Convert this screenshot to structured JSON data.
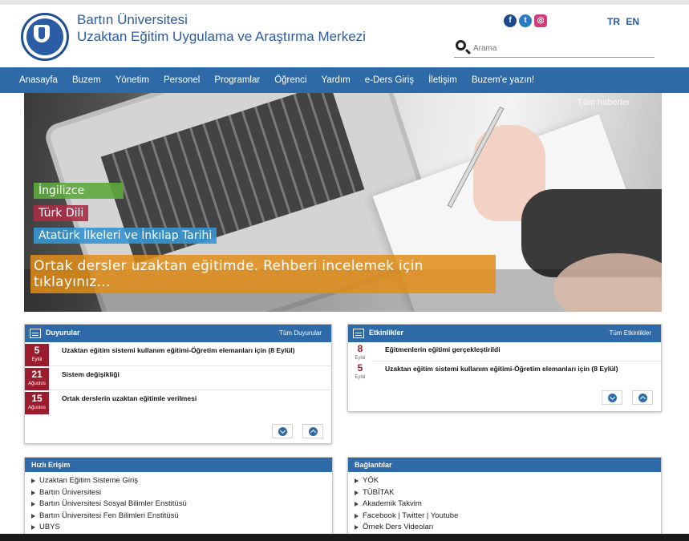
{
  "header": {
    "title_line1": "Bartın Üniversitesi",
    "title_line2": "Uzaktan Eğitim Uygulama ve Araştırma Merkezi",
    "search_placeholder": "Arama",
    "languages": [
      "TR",
      "EN"
    ],
    "social": [
      {
        "name": "facebook",
        "glyph": "f"
      },
      {
        "name": "twitter",
        "glyph": "t"
      },
      {
        "name": "instagram",
        "glyph": "◎"
      }
    ]
  },
  "nav": {
    "items": [
      "Anasayfa",
      "Buzem",
      "Yönetim",
      "Personel",
      "Programlar",
      "Öğrenci",
      "Yardım",
      "e-Ders Giriş",
      "İletişim",
      "Buzem'e yazın!"
    ]
  },
  "hero": {
    "all_news": "Tüm haberler",
    "tags": [
      "İngilizce",
      "Türk Dili",
      "Atatürk İlkeleri ve İnkılap Tarihi"
    ],
    "headline": "Ortak dersler uzaktan eğitimde. Rehberi incelemek için tıklayınız..."
  },
  "announcements": {
    "title": "Duyurular",
    "all_link": "Tüm Duyurular",
    "items": [
      {
        "day": "5",
        "month": "Eylül",
        "text": "Uzaktan eğitim sistemi kullanım eğitimi-Öğretim elemanları için (8 Eylül)"
      },
      {
        "day": "21",
        "month": "Ağustos",
        "text": "Sistem değişikliği"
      },
      {
        "day": "15",
        "month": "Ağustos",
        "text": "Ortak derslerin uzaktan eğitimle verilmesi"
      }
    ]
  },
  "events": {
    "title": "Etkinlikler",
    "all_link": "Tüm Etkinlikler",
    "items": [
      {
        "day": "8",
        "month": "Eylül",
        "text": "Eğitmenlerin eğitimi gerçekleştirildi"
      },
      {
        "day": "5",
        "month": "Eylül",
        "text": "Uzaktan eğitim sistemi kullanım eğitimi-Öğretim elemanları için (8 Eylül)"
      }
    ]
  },
  "quick_access": {
    "title": "Hızlı Erişim",
    "items": [
      "Uzaktan Eğitim Sisteme Giriş",
      "Bartın Üniversitesi",
      "Bartın Üniversitesi Sosyal Bilimler Enstitüsü",
      "Bartın Üniversitesi Fen Bilimleri Enstitüsü",
      "UBYS"
    ]
  },
  "links": {
    "title": "Bağlantılar",
    "items": [
      "YÖK",
      "TÜBİTAK",
      "Akademik Takvim",
      "Facebook | Twitter | Youtube",
      "Örnek Ders Videoları"
    ]
  }
}
